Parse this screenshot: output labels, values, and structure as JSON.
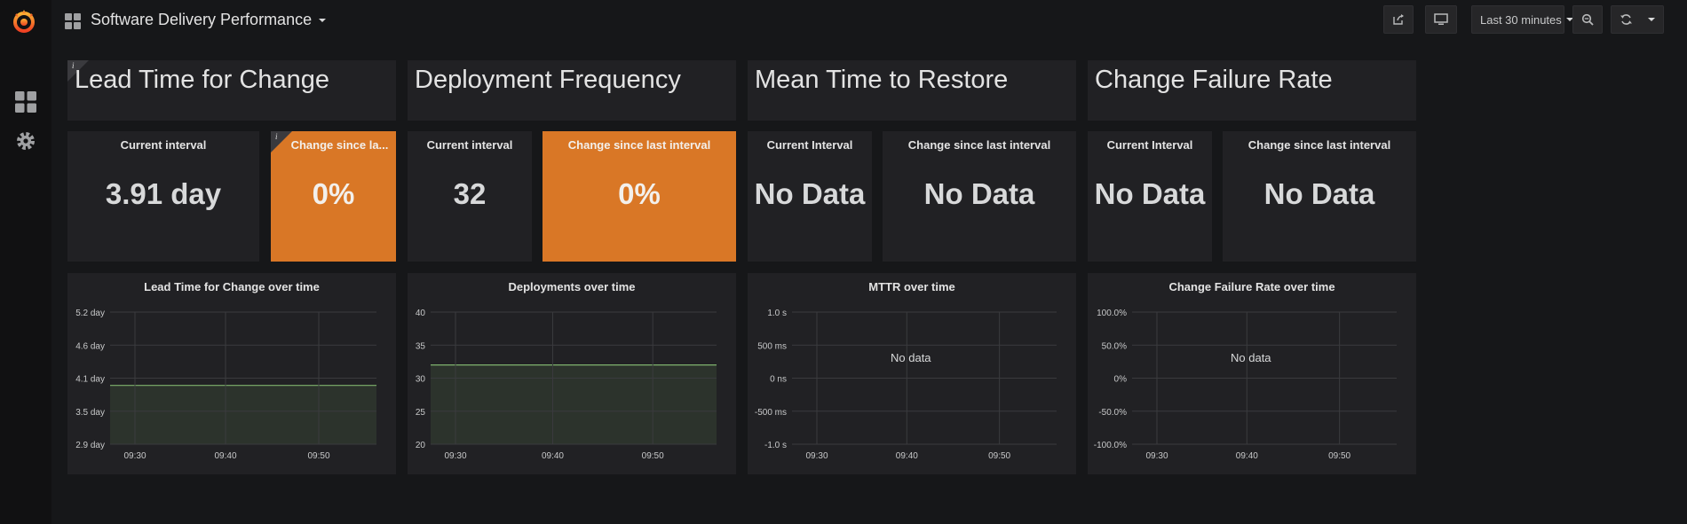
{
  "header": {
    "dashboard_title": "Software Delivery Performance",
    "time_range_label": "Last 30 minutes"
  },
  "colors": {
    "accent_orange": "#d97726",
    "panel_bg": "#212124",
    "series_green": "#7eb26d"
  },
  "rows": {
    "titles": [
      "Lead Time for Change",
      "Deployment Frequency",
      "Mean Time to Restore",
      "Change Failure Rate"
    ],
    "stats": [
      {
        "title": "Current interval",
        "value": "3.91 day"
      },
      {
        "title": "Change since la...",
        "value": "0%"
      },
      {
        "title": "Current interval",
        "value": "32"
      },
      {
        "title": "Change since last interval",
        "value": "0%"
      },
      {
        "title": "Current Interval",
        "value": "No Data"
      },
      {
        "title": "Change since last interval",
        "value": "No Data"
      },
      {
        "title": "Current Interval",
        "value": "No Data"
      },
      {
        "title": "Change since last interval",
        "value": "No Data"
      }
    ]
  },
  "graphs": [
    {
      "title": "Lead Time for Change over time",
      "y_ticks": [
        "5.2 day",
        "4.6 day",
        "4.1 day",
        "3.5 day",
        "2.9 day"
      ],
      "x_ticks": [
        "09:30",
        "09:40",
        "09:50"
      ],
      "series_level": 0.445,
      "no_data": ""
    },
    {
      "title": "Deployments over time",
      "y_ticks": [
        "40",
        "35",
        "30",
        "25",
        "20"
      ],
      "x_ticks": [
        "09:30",
        "09:40",
        "09:50"
      ],
      "series_level": 0.6,
      "no_data": ""
    },
    {
      "title": "MTTR over time",
      "y_ticks": [
        "1.0 s",
        "500 ms",
        "0 ns",
        "-500 ms",
        "-1.0 s"
      ],
      "x_ticks": [
        "09:30",
        "09:40",
        "09:50"
      ],
      "series_level": null,
      "no_data": "No data"
    },
    {
      "title": "Change Failure Rate over time",
      "y_ticks": [
        "100.0%",
        "50.0%",
        "0%",
        "-50.0%",
        "-100.0%"
      ],
      "x_ticks": [
        "09:30",
        "09:40",
        "09:50"
      ],
      "series_level": null,
      "no_data": "No data"
    }
  ]
}
